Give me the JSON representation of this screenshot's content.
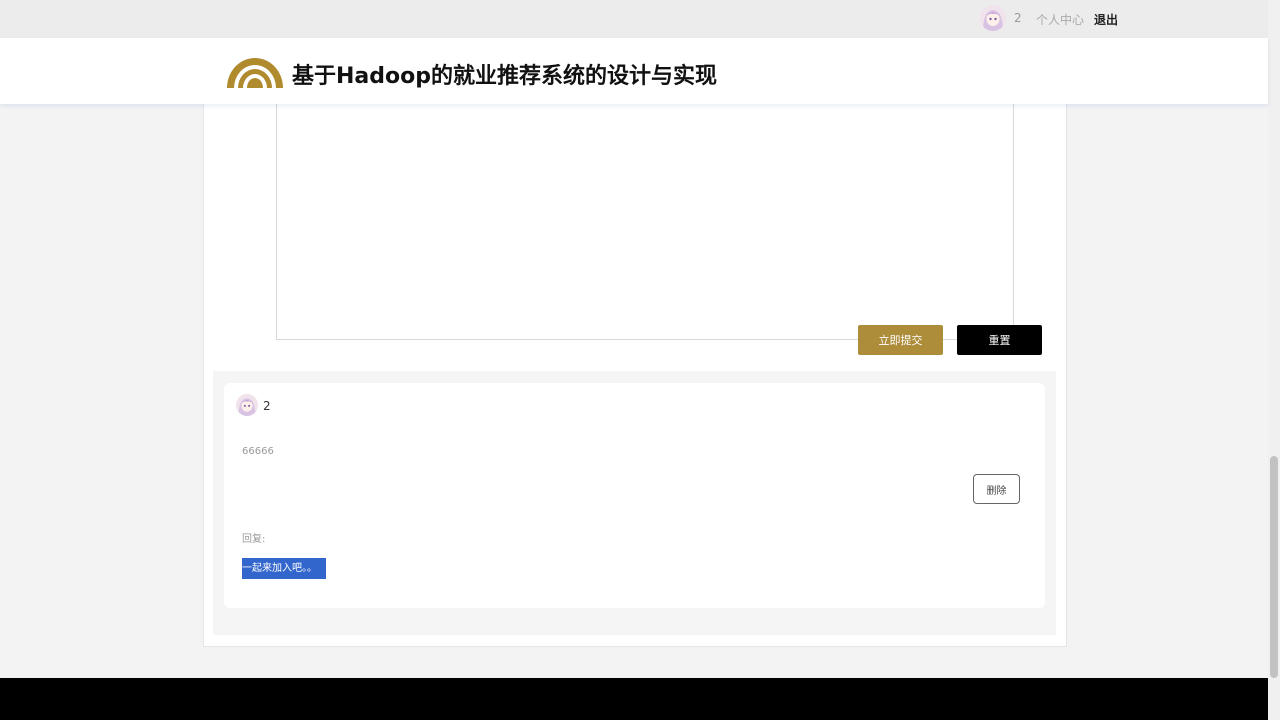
{
  "topbar": {
    "username": "2",
    "personal_center": "个人中心",
    "logout": "退出"
  },
  "header": {
    "title": "基于Hadoop的就业推荐系统的设计与实现"
  },
  "form": {
    "submit_label": "立即提交",
    "reset_label": "重置"
  },
  "comment": {
    "username": "2",
    "content": "66666",
    "delete_label": "删除",
    "reply_label": "回复:",
    "reply_content": "一起来加入吧。。"
  },
  "colors": {
    "accent": "#ad8d3a",
    "selection": "#3366cc"
  }
}
